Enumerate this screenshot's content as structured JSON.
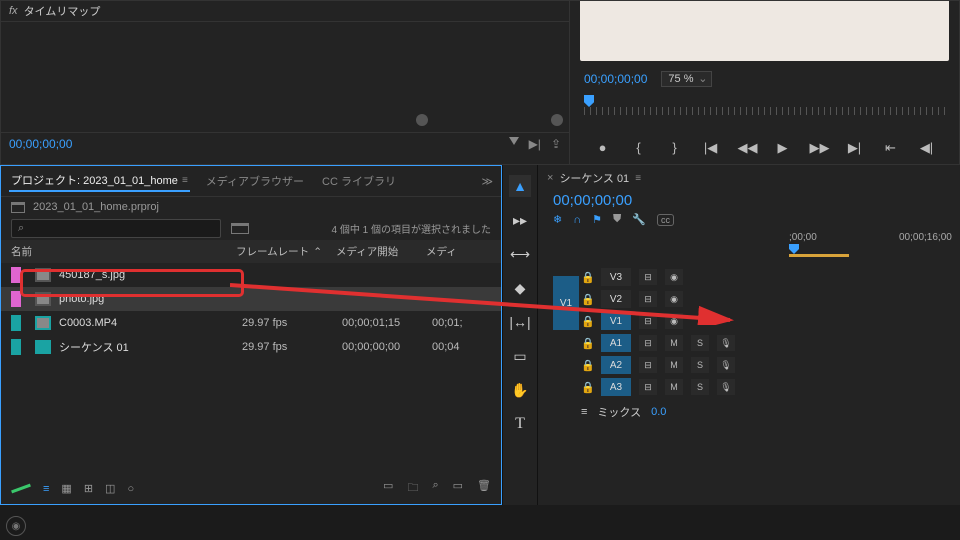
{
  "effects": {
    "time_remap": "タイムリマップ",
    "fx": "fx"
  },
  "source": {
    "tc": "00;00;00;00"
  },
  "program": {
    "tc": "00;00;00;00",
    "zoom": "75 %",
    "transport": {
      "add_marker": "●",
      "in": "{",
      "out": "}",
      "prev": "|◀",
      "back": "◀◀",
      "play": "▶",
      "fwd": "▶▶",
      "next": "▶|",
      "bracket_l": "⇤",
      "bracket_r": "◀|"
    }
  },
  "project": {
    "tabs": {
      "project": "プロジェクト: 2023_01_01_home",
      "media": "メディアブラウザー",
      "cc": "CC ライブラリ"
    },
    "file": "2023_01_01_home.prproj",
    "search_icon": "⌕",
    "selection": "4 個中 1 個の項目が選択されました",
    "columns": {
      "name": "名前",
      "fr": "フレームレート",
      "ms": "メディア開始",
      "me": "メディ"
    },
    "items": [
      {
        "name": "450187_s.jpg",
        "fr": "",
        "ms": "",
        "me": ""
      },
      {
        "name": "photo.jpg",
        "fr": "",
        "ms": "",
        "me": ""
      },
      {
        "name": "C0003.MP4",
        "fr": "29.97 fps",
        "ms": "00;00;01;15",
        "me": "00;01;"
      },
      {
        "name": "シーケンス 01",
        "fr": "29.97 fps",
        "ms": "00;00;00;00",
        "me": "00;04"
      }
    ],
    "footer_icons": {
      "list": "≡",
      "icon": "▦",
      "free": "⊞",
      "auto": "◫",
      "o": "○",
      "new": "▭",
      "folder": "🗀",
      "find": "⌕",
      "trash": "🗑"
    }
  },
  "tools": {
    "select": "▲",
    "track": "▸▸",
    "ripple": "⟷",
    "razor": "◆",
    "slip": "|↔|",
    "pen": "▭",
    "hand": "✋",
    "type": "T"
  },
  "timeline": {
    "tab": "シーケンス 01",
    "tc": "00;00;00;00",
    "icons": {
      "snap": "❄",
      "link": "∩",
      "marker": "⚑",
      "shield": "⛊",
      "wrench": "🔧",
      "cc": "cc"
    },
    "ruler": {
      "t0": ";00;00",
      "t1": "00;00;16;00"
    },
    "tracks": {
      "v3": "V3",
      "v2": "V2",
      "v1": "V1",
      "a1": "A1",
      "a2": "A2",
      "a3": "A3",
      "toggle": "⊟",
      "eye": "👁",
      "m": "M",
      "s": "S",
      "mic": "🎙"
    },
    "mix": {
      "label": "ミックス",
      "value": "0.0",
      "icon": "≡"
    }
  },
  "cc_badge": "◉"
}
